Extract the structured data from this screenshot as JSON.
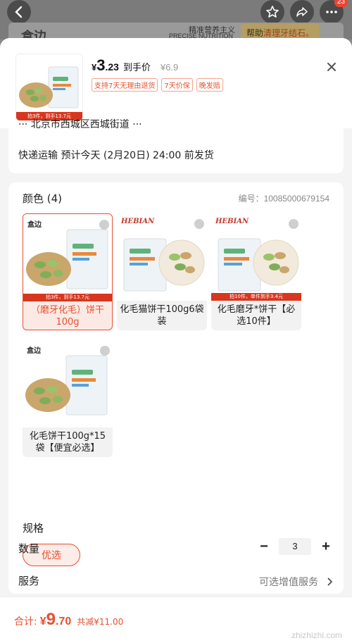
{
  "topbar": {
    "cart_badge": "23"
  },
  "banner": {
    "brand": "盒边",
    "tagline_cn": "精准营养主义",
    "tagline_en": "PRECISE NUTRITION",
    "promo_prefix": "帮助",
    "promo_highlight": "清理牙结石。"
  },
  "product": {
    "price_symbol": "¥",
    "price_int": "3",
    "price_dec": ".23",
    "price_label": "到手价",
    "orig_price": "¥6.9",
    "tags": [
      "支持7天无理由退货",
      "7天价保",
      "晚发赔"
    ],
    "thumb_strip": "拍3件，到手13.7元"
  },
  "shipping": {
    "address_cut": "··· 北京市西城区西城街道 ···",
    "text": "快递运输 预计今天 (2月20日) 24:00 前发货"
  },
  "options": {
    "color_title": "颜色 (4)",
    "sku_no": "编号：10085000679154",
    "colors": [
      {
        "label": "（磨牙化毛）饼干100g",
        "strip": "拍3件，到手13.7元",
        "brand": "盒边"
      },
      {
        "label": "化毛猫饼干100g6袋装",
        "strip": "",
        "brand": "HEBIAN"
      },
      {
        "label": "化毛磨牙*饼干【必选10件】",
        "strip": "拍10件，单件到手3.4元",
        "brand": "HEBIAN"
      },
      {
        "label": "化毛饼干100g*15袋【便宜必选】",
        "strip": "",
        "brand": "盒边"
      }
    ],
    "spec_title": "规格",
    "spec_value": "优选"
  },
  "quantity": {
    "label": "数量",
    "value": "3",
    "minus": "−",
    "plus": "+"
  },
  "service": {
    "label": "服务",
    "value": "可选增值服务"
  },
  "footer": {
    "total_label": "合计:",
    "total_symbol": "¥",
    "total_int": "9",
    "total_dec": ".70",
    "saved": "共减¥11.00",
    "watermark": "zhizhizhi.com"
  },
  "colors": {
    "accent": "#e5502f",
    "selected_bg": "#fde9e4"
  }
}
